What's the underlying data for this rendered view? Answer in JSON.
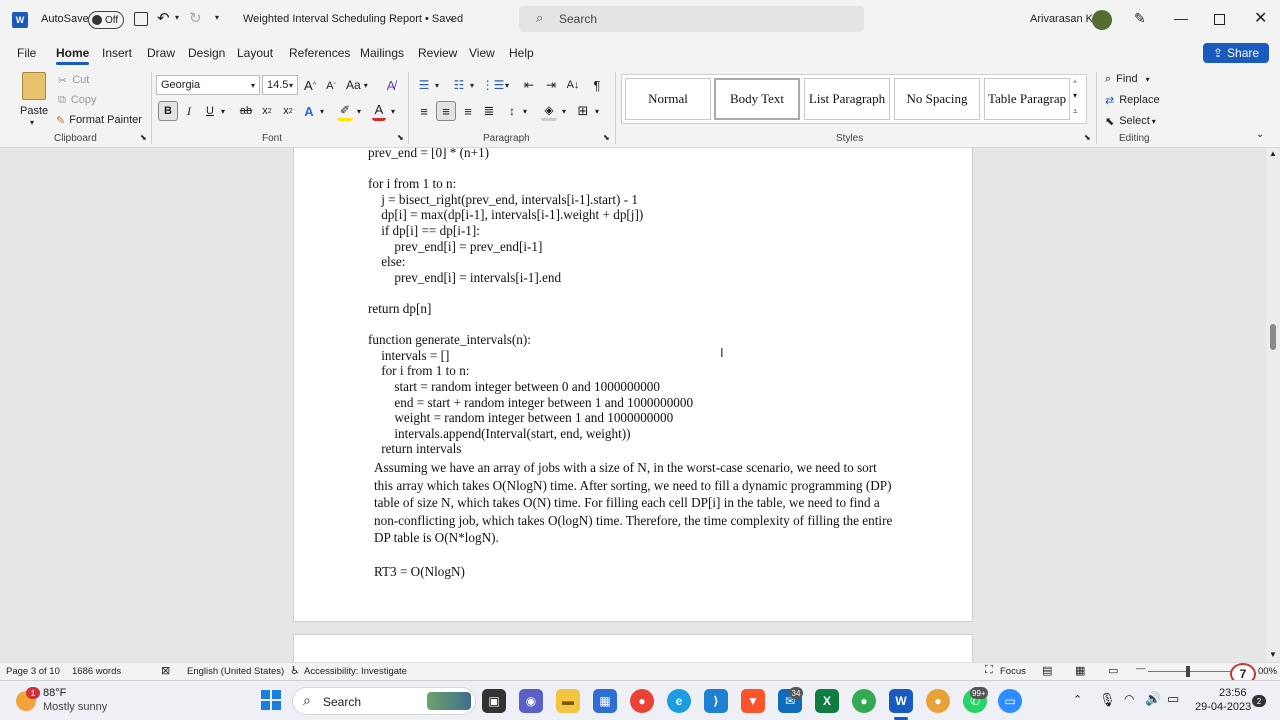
{
  "titlebar": {
    "autosave_label": "AutoSave",
    "autosave_state": "Off",
    "doc_title": "Weighted Interval Scheduling Report • Saved",
    "search_placeholder": "Search",
    "user_name": "Arivarasan K"
  },
  "menu": {
    "items": [
      "File",
      "Home",
      "Insert",
      "Draw",
      "Design",
      "Layout",
      "References",
      "Mailings",
      "Review",
      "View",
      "Help"
    ],
    "active": "Home",
    "share_label": "Share"
  },
  "ribbon": {
    "clipboard": {
      "paste": "Paste",
      "cut": "Cut",
      "copy": "Copy",
      "format_painter": "Format Painter",
      "label": "Clipboard"
    },
    "font": {
      "family": "Georgia",
      "size": "14.5",
      "label": "Font",
      "bold": "B",
      "italic": "I",
      "underline": "U",
      "aa": "Aa"
    },
    "paragraph": {
      "label": "Paragraph"
    },
    "styles": {
      "items": [
        "Normal",
        "Body Text",
        "List Paragraph",
        "No Spacing",
        "Table Paragrap"
      ],
      "selected": "Body Text",
      "label": "Styles"
    },
    "editing": {
      "find": "Find",
      "replace": "Replace",
      "select": "Select",
      "label": "Editing"
    }
  },
  "document": {
    "code_lines": [
      "prev_end = [0] * (n+1)",
      "",
      "for i from 1 to n:",
      "    j = bisect_right(prev_end, intervals[i-1].start) - 1",
      "    dp[i] = max(dp[i-1], intervals[i-1].weight + dp[j])",
      "    if dp[i] == dp[i-1]:",
      "        prev_end[i] = prev_end[i-1]",
      "    else:",
      "        prev_end[i] = intervals[i-1].end",
      "",
      "return dp[n]",
      "",
      "function generate_intervals(n):",
      "    intervals = []",
      "    for i from 1 to n:",
      "        start = random integer between 0 and 1000000000",
      "        end = start + random integer between 1 and 1000000000",
      "        weight = random integer between 1 and 1000000000",
      "        intervals.append(Interval(start, end, weight))",
      "    return intervals"
    ],
    "paragraph": "Assuming we have an array of jobs with a size of N, in the worst-case scenario, we need to sort this array which takes O(NlogN) time. After sorting, we need to fill a dynamic programming (DP) table of size N, which takes O(N) time. For filling each cell DP[i] in the table, we need to find a non-conflicting job, which takes O(logN) time. Therefore, the time complexity of filling the entire DP table is O(N*logN).",
    "result_line": "RT3 = O(NlogN)"
  },
  "statusbar": {
    "page": "Page 3 of 10",
    "words": "1686 words",
    "language": "English (United States)",
    "accessibility": "Accessibility: Investigate",
    "focus": "Focus",
    "zoom": "00%"
  },
  "taskbar": {
    "weather_temp": "88°F",
    "weather_desc": "Mostly sunny",
    "weather_badge": "1",
    "search_label": "Search",
    "time": "23:56",
    "date": "29-04-2023",
    "notif_count": "2",
    "mail_badge": "34",
    "whatsapp_badge": "99+",
    "overlay_number": "7"
  }
}
